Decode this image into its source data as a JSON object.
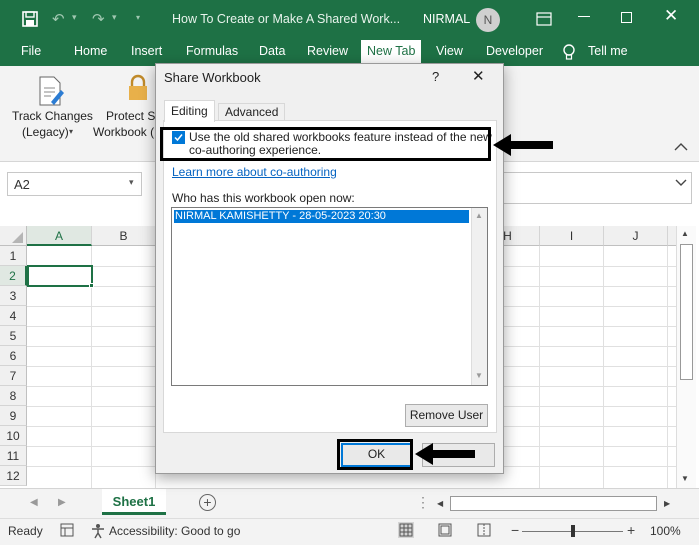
{
  "window": {
    "title": "How To Create or Make A Shared Work...",
    "user_name": "NIRMAL",
    "avatar_initial": "N"
  },
  "ribbon_tabs": [
    "File",
    "Home",
    "Insert",
    "Formulas",
    "Data",
    "Review",
    "New Tab",
    "View",
    "Developer",
    "Tell me"
  ],
  "active_tab": "New Tab",
  "ribbon": {
    "track_changes_line1": "Track Changes",
    "track_changes_line2": "(Legacy)",
    "protect_line1": "Protect Sh",
    "protect_line2": "Workbook ("
  },
  "name_box": "A2",
  "columns": [
    "A",
    "B",
    "H",
    "I",
    "J"
  ],
  "rows": [
    "1",
    "2",
    "3",
    "4",
    "5",
    "6",
    "7",
    "8",
    "9",
    "10",
    "11",
    "12"
  ],
  "sheet_tab": "Sheet1",
  "status": {
    "ready": "Ready",
    "accessibility": "Accessibility: Good to go",
    "zoom": "100%"
  },
  "dialog": {
    "title": "Share Workbook",
    "help": "?",
    "tabs": [
      "Editing",
      "Advanced"
    ],
    "checkbox_label_line1": "Use the old shared workbooks feature instead of the new",
    "checkbox_label_line2": "co-authoring experience.",
    "checkbox_checked": true,
    "learn_more_link": "Learn more about co-authoring",
    "who_label": "Who has this workbook open now:",
    "users": [
      "NIRMAL KAMISHETTY - 28-05-2023 20:30"
    ],
    "remove_user_button": "Remove User",
    "ok_button": "OK"
  },
  "colors": {
    "excel_green": "#1e7145",
    "selection_blue": "#0078d7",
    "link_blue": "#0563c1"
  }
}
